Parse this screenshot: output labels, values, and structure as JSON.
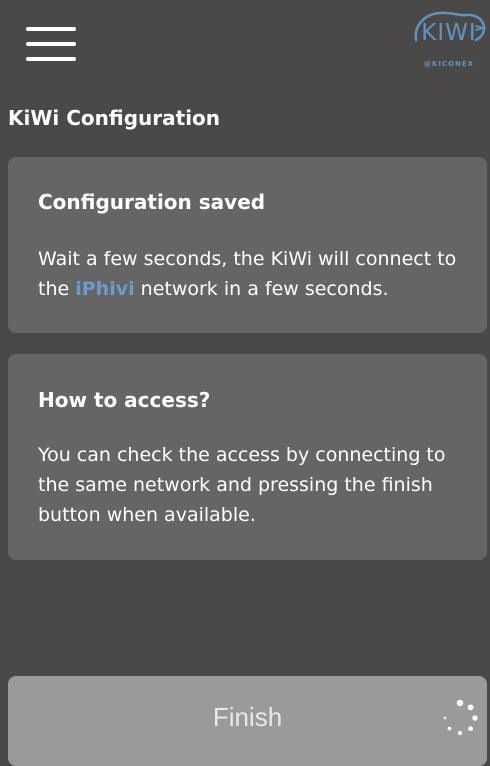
{
  "header": {
    "menu_icon": "hamburger-menu-icon",
    "logo": {
      "brand": "KIWI",
      "subtitle": "@KICONEX",
      "color": "#5c94c6"
    }
  },
  "page": {
    "title": "KiWi Configuration"
  },
  "cards": {
    "saved": {
      "title": "Configuration saved",
      "text_before": "Wait a few seconds, the KiWi will connect to the ",
      "network": "iPhivi",
      "text_after": " network in a few seconds."
    },
    "access": {
      "title": "How to access?",
      "text": "You can check the access by connecting to the same network and pressing the finish button when available."
    }
  },
  "footer": {
    "finish_label": "Finish",
    "spinner_icon": "loading-spinner-icon"
  },
  "colors": {
    "background": "#4b4948",
    "card": "#666565",
    "accent": "#6b9bc9",
    "button": "#9a9a9a"
  }
}
